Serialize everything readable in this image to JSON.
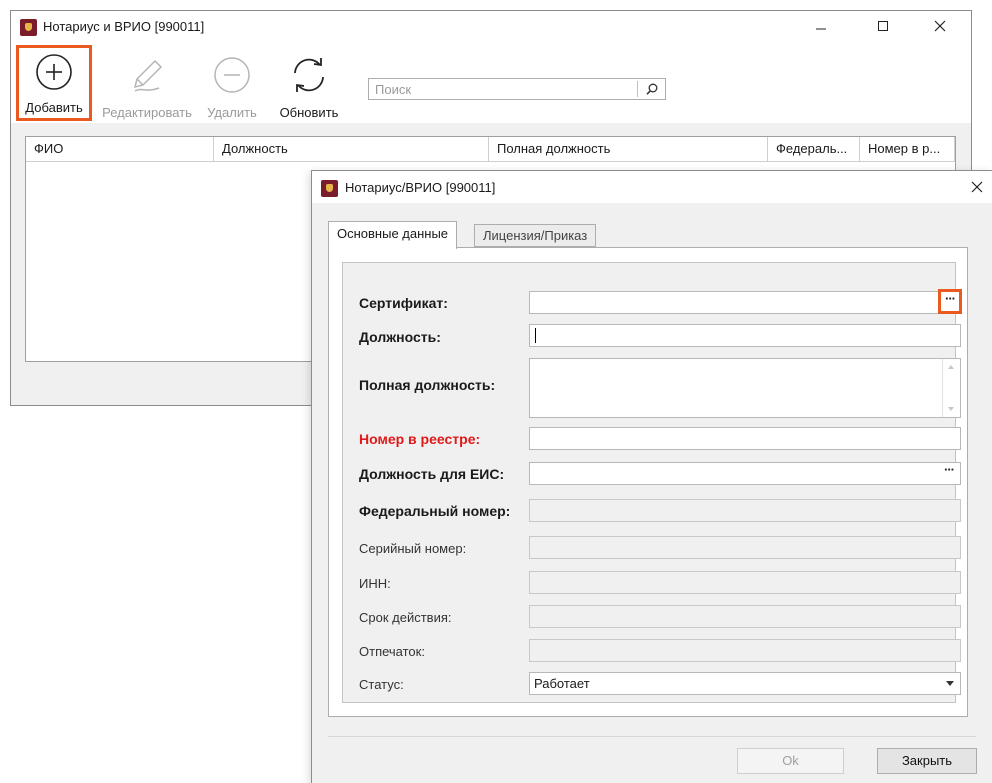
{
  "main_window": {
    "title": "Нотариус и ВРИО [990011]",
    "toolbar": {
      "add": "Добавить",
      "edit": "Редактировать",
      "delete": "Удалить",
      "refresh": "Обновить"
    },
    "search": {
      "placeholder": "Поиск",
      "value": ""
    },
    "grid": {
      "columns": [
        "ФИО",
        "Должность",
        "Полная должность",
        "Федераль...",
        "Номер в р..."
      ]
    }
  },
  "dialog": {
    "title": "Нотариус/ВРИО [990011]",
    "tabs": [
      "Основные данные",
      "Лицензия/Приказ"
    ],
    "active_tab": "Основные данные",
    "fields": {
      "certificate": {
        "label": "Сертификат:",
        "value": ""
      },
      "position": {
        "label": "Должность:",
        "value": ""
      },
      "full_position": {
        "label": "Полная должность:",
        "value": ""
      },
      "registry_number": {
        "label": "Номер в реестре:",
        "value": ""
      },
      "eis_position": {
        "label": "Должность для ЕИС:",
        "value": ""
      },
      "federal_number": {
        "label": "Федеральный номер:",
        "value": ""
      },
      "serial_number": {
        "label": "Серийный номер:",
        "value": ""
      },
      "inn": {
        "label": "ИНН:",
        "value": ""
      },
      "validity": {
        "label": "Срок действия:",
        "value": ""
      },
      "fingerprint": {
        "label": "Отпечаток:",
        "value": ""
      },
      "status": {
        "label": "Статус:",
        "value": "Работает"
      }
    },
    "ellipsis": "···",
    "buttons": {
      "ok": "Ok",
      "close": "Закрыть"
    }
  },
  "colors": {
    "highlight": "#ea5a20",
    "required_label": "#e01a1a",
    "logo": "#7a1c2a"
  }
}
